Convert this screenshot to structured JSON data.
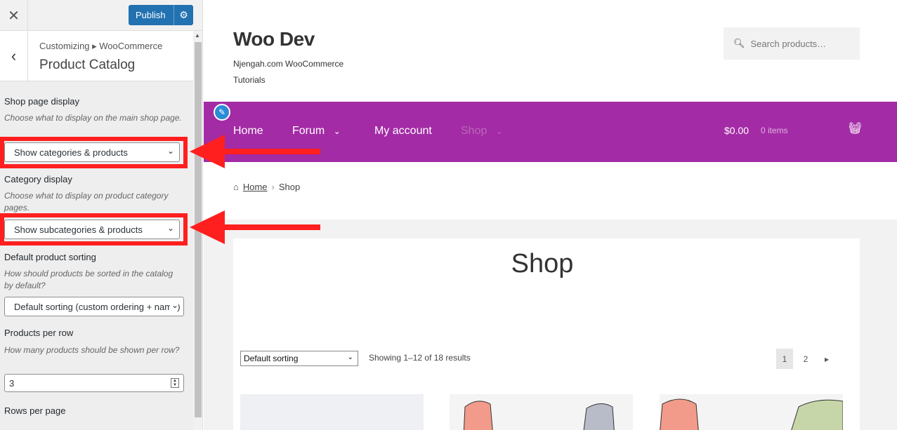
{
  "customizer": {
    "close_icon": "close-icon",
    "publish_label": "Publish",
    "publish_settings_icon": "gear-icon",
    "breadcrumb": "Customizing ▸ WooCommerce",
    "section_title": "Product Catalog",
    "fields": {
      "shop_display": {
        "label": "Shop page display",
        "description": "Choose what to display on the main shop page.",
        "value": "Show categories & products"
      },
      "category_display": {
        "label": "Category display",
        "description": "Choose what to display on product category pages.",
        "value": "Show subcategories & products"
      },
      "default_sorting": {
        "label": "Default product sorting",
        "description": "How should products be sorted in the catalog by default?",
        "value": "Default sorting (custom ordering + name)"
      },
      "products_per_row": {
        "label": "Products per row",
        "description": "How many products should be shown per row?",
        "value": "3"
      },
      "rows_per_page": {
        "label": "Rows per page"
      }
    },
    "highlight_color": "#ff1f1f"
  },
  "site": {
    "title": "Woo Dev",
    "tagline": "Njengah.com WooCommerce Tutorials",
    "search_placeholder": "Search products…",
    "nav_color": "#a32ba5",
    "nav": [
      "Home",
      "Forum",
      "My account",
      "Shop"
    ],
    "cart_amount": "$0.00",
    "cart_count": "0 items",
    "breadcrumb": {
      "home": "Home",
      "current": "Shop"
    },
    "page_title": "Shop",
    "sorting_value": "Default sorting",
    "result_count": "Showing 1–12 of 18 results",
    "pages": [
      "1",
      "2"
    ]
  }
}
